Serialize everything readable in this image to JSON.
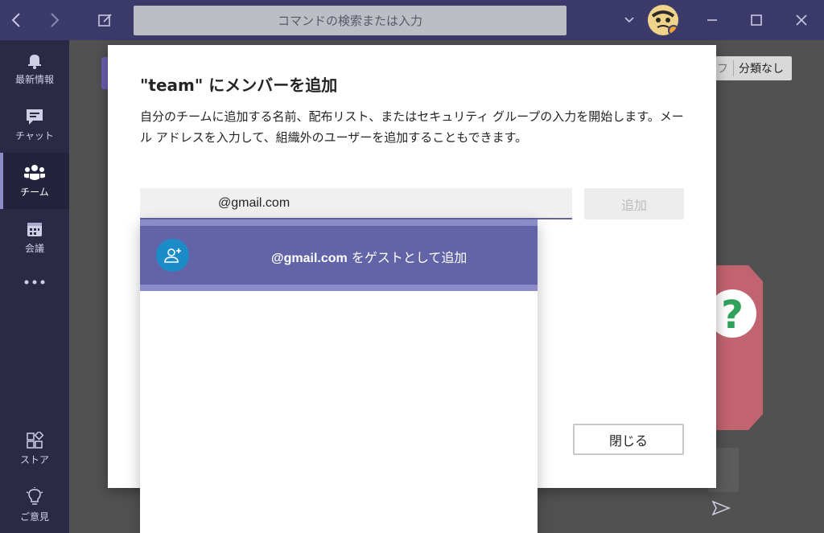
{
  "titlebar": {
    "search_placeholder": "コマンドの検索または入力"
  },
  "rail": {
    "items": [
      {
        "label": "最新情報",
        "icon": "bell-icon"
      },
      {
        "label": "チャット",
        "icon": "chat-icon"
      },
      {
        "label": "チーム",
        "icon": "teams-icon",
        "active": true
      },
      {
        "label": "会議",
        "icon": "calendar-icon"
      },
      {
        "label": "ストア",
        "icon": "store-icon"
      },
      {
        "label": "ご意見",
        "icon": "lightbulb-icon"
      }
    ]
  },
  "background": {
    "chip_label": "分類なし",
    "chip_prefix": "フ"
  },
  "dialog": {
    "title": "\"team\" にメンバーを追加",
    "description": "自分のチームに追加する名前、配布リスト、またはセキュリティ グループの入力を開始します。メール アドレスを入力して、組織外のユーザーを追加することもできます。",
    "input_value": "@gmail.com",
    "add_button": "追加",
    "close_button": "閉じる"
  },
  "dropdown": {
    "suggestion_email": "@gmail.com",
    "suggestion_suffix": " をゲストとして追加"
  },
  "colors": {
    "accent": "#6264a7",
    "rail_bg": "#2a2a47",
    "titlebar_bg": "#3b3a6a"
  }
}
